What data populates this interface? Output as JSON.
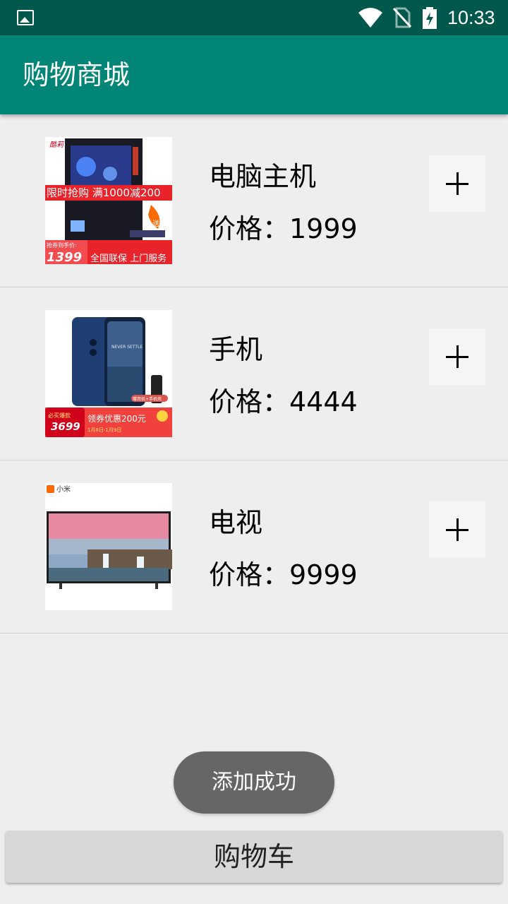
{
  "status_bar": {
    "time": "10:33",
    "icons": [
      "gallery-icon",
      "wifi-icon",
      "no-sim-icon",
      "battery-charging-icon"
    ]
  },
  "app_bar": {
    "title": "购物商城"
  },
  "products": [
    {
      "name": "电脑主机",
      "price": "价格：1999",
      "image_text": {
        "brand": "酷莉",
        "banner": "限时抢购 满1000减200",
        "badge": "送",
        "price_label": "抢券到手价:",
        "price": "1399",
        "service": "全国联保 上门服务"
      }
    },
    {
      "name": "手机",
      "price": "价格：4444",
      "image_text": {
        "screen": "NEVER SETTLE",
        "gift": "赠耳机+手机壳",
        "tag": "必买爆款",
        "price": "3699",
        "coupon": "领券优惠200元",
        "dates": "1月8日-1月9日"
      }
    },
    {
      "name": "电视",
      "price": "价格：9999",
      "image_text": {
        "brand": "小米"
      }
    }
  ],
  "toast": {
    "text": "添加成功"
  },
  "cart_button": {
    "label": "购物车"
  },
  "colors": {
    "status_bar": "#00574b",
    "app_bar": "#008577",
    "background": "#eeeeee",
    "toast": "#666666"
  }
}
